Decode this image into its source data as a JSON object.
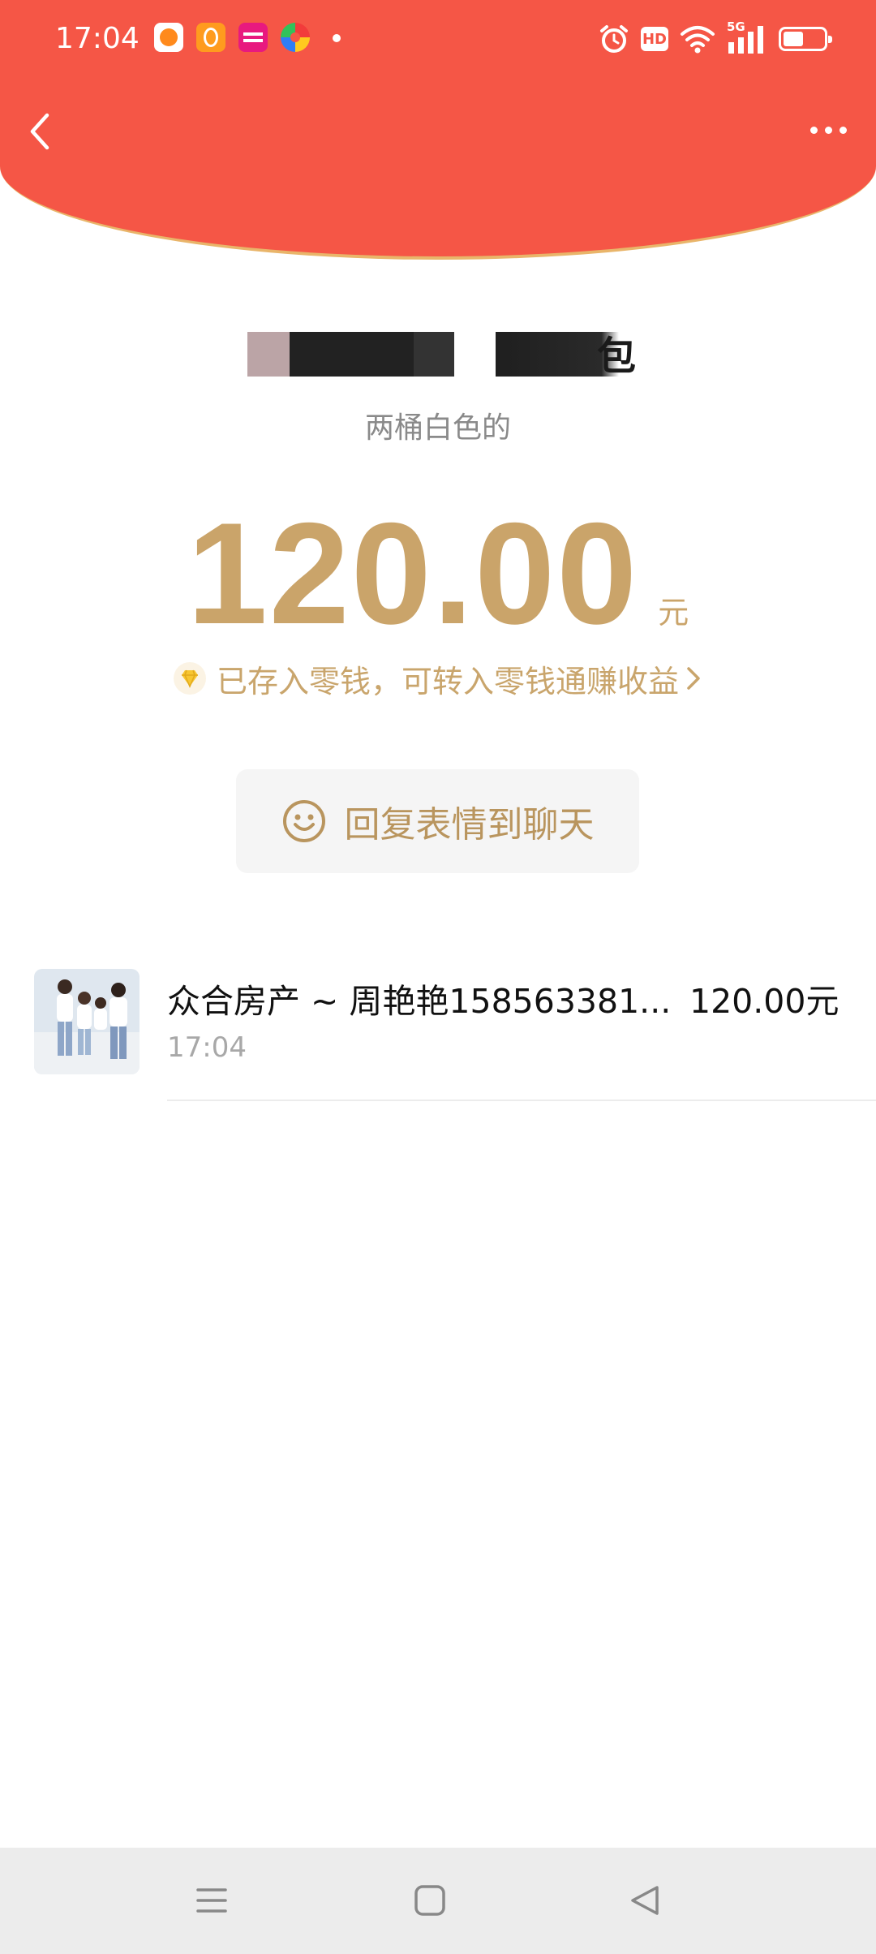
{
  "status_bar": {
    "time": "17:04",
    "notification_icons": [
      "shopping-app-icon",
      "video-app-icon",
      "mall-app-icon",
      "colorful-app-icon"
    ],
    "network": "5G",
    "hd_label": "HD",
    "battery_level": 0.5
  },
  "header": {
    "back_icon": "chevron-left-icon",
    "menu_icon": "more-icon"
  },
  "red_packet": {
    "sender_suffix": "包",
    "remark": "两桶白色的",
    "amount": "120.00",
    "unit": "元",
    "balance_note": "已存入零钱，可转入零钱通赚收益",
    "reply_label": "回复表情到聊天"
  },
  "records": [
    {
      "name": "众合房产 ~ 周艳艳158563381...",
      "amount": "120.00元",
      "time": "17:04"
    }
  ],
  "nav_bar": {
    "buttons": [
      "menu-icon",
      "home-icon",
      "back-icon"
    ]
  },
  "colors": {
    "header_red": "#f55646",
    "header_border_gold": "#e9b56a",
    "amount_gold": "#caa46a",
    "reply_button_bg": "#f5f5f5"
  }
}
